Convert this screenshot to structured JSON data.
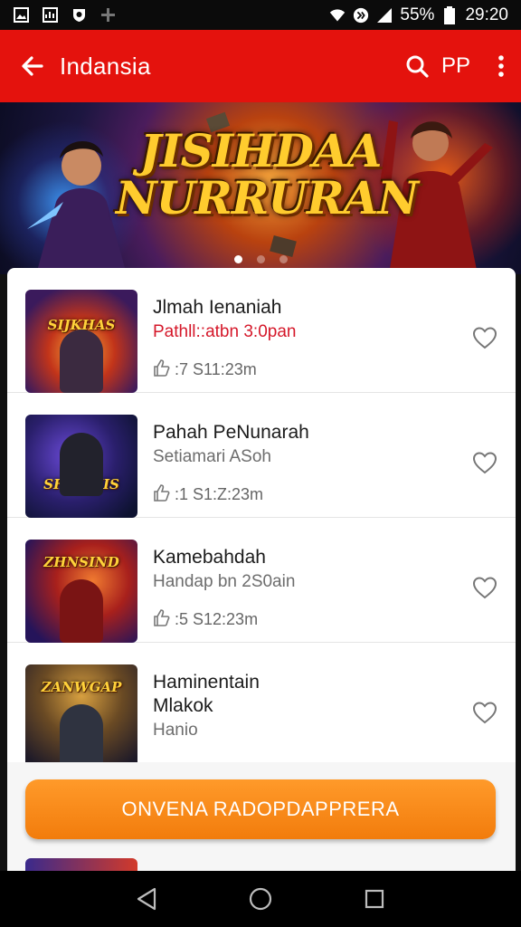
{
  "status_bar": {
    "battery_percent": "55%",
    "time": "29:20",
    "icons": [
      "image-icon",
      "gallery-icon",
      "shield-icon",
      "fan-icon",
      "wifi-icon",
      "data-icon",
      "signal-icon",
      "battery-icon"
    ]
  },
  "app_bar": {
    "title": "Indansia",
    "pp_label": "PP",
    "icons": [
      "back-arrow-icon",
      "search-icon",
      "more-vert-icon"
    ]
  },
  "banner": {
    "title_line1": "JISIHDAA",
    "title_line2": "NURRURAN",
    "slides": 3,
    "active_slide": 0
  },
  "list": [
    {
      "title": "Jlmah Ienaniah",
      "subtitle": "Pathll::atbn 3:0pan",
      "subtitle_color": "#d5182a",
      "meta": ":7 S11:23m",
      "thumb_label": "SIJKHAS"
    },
    {
      "title": "Pahah PeNunarah",
      "subtitle": "Setiamari ASoh",
      "subtitle_color": "#6d6d6d",
      "meta": ":1 S1:Z:23m",
      "thumb_label": "SHNKHIS"
    },
    {
      "title": "Kamebahdah",
      "subtitle": "Handap bn 2S0ain",
      "subtitle_color": "#6d6d6d",
      "meta": ":5 S12:23m",
      "thumb_label": "ZHNSIND"
    },
    {
      "title": "Haminentain",
      "title2": "Mlakok",
      "subtitle": "Hanio",
      "subtitle_color": "#6d6d6d",
      "meta": "",
      "thumb_label": "ZANWGAP"
    }
  ],
  "cta": {
    "label": "ONVENA RADOPDAPPRERA"
  },
  "colors": {
    "app_bar": "#e4120d",
    "cta": "#f58a1a",
    "accent_red": "#d5182a"
  },
  "nav_bar": {
    "icons": [
      "back-triangle-icon",
      "home-circle-icon",
      "recents-square-icon"
    ]
  }
}
